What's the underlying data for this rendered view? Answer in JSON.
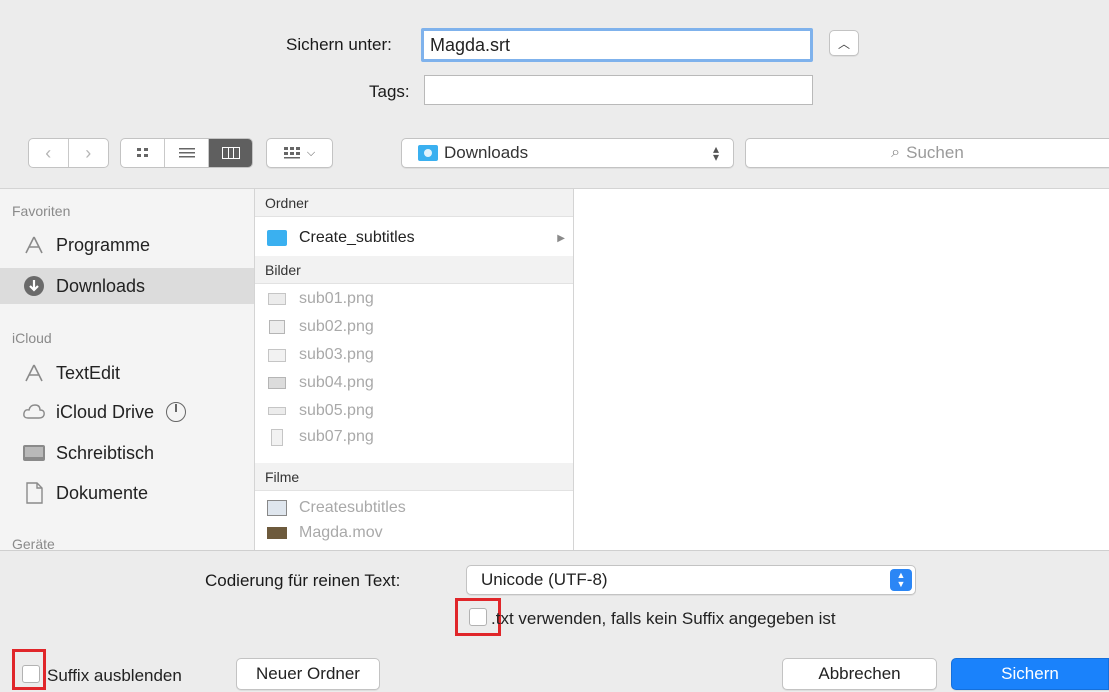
{
  "save_as": {
    "label": "Sichern unter:",
    "value": "Magda.srt"
  },
  "tags": {
    "label": "Tags:",
    "value": ""
  },
  "toolbar": {
    "location": "Downloads",
    "search_placeholder": "Suchen"
  },
  "sidebar": {
    "favorites_header": "Favoriten",
    "icloud_header": "iCloud",
    "devices_header": "Geräte",
    "items": [
      {
        "label": "Programme",
        "icon": "apps-icon"
      },
      {
        "label": "Downloads",
        "icon": "downloads-icon",
        "selected": true
      },
      {
        "label": "TextEdit",
        "icon": "apps-icon"
      },
      {
        "label": "iCloud Drive",
        "icon": "cloud-icon"
      },
      {
        "label": "Schreibtisch",
        "icon": "desktop-icon"
      },
      {
        "label": "Dokumente",
        "icon": "document-icon"
      }
    ]
  },
  "files": {
    "folders_header": "Ordner",
    "folder": "Create_subtitles",
    "images_header": "Bilder",
    "images": [
      "sub01.png",
      "sub02.png",
      "sub03.png",
      "sub04.png",
      "sub05.png",
      "sub07.png"
    ],
    "movies_header": "Filme",
    "movies": [
      "Createsubtitles",
      "Magda.mov"
    ]
  },
  "encoding": {
    "label": "Codierung für reinen Text:",
    "value": "Unicode (UTF-8)",
    "txt_checkbox_label": ".txt verwenden, falls kein Suffix angegeben ist"
  },
  "footer": {
    "hide_suffix_label": "Suffix ausblenden",
    "new_folder": "Neuer Ordner",
    "cancel": "Abbrechen",
    "save": "Sichern"
  },
  "colors": {
    "accent": "#1a82fb",
    "highlight": "#e0262a",
    "folder": "#3ab0f0"
  }
}
